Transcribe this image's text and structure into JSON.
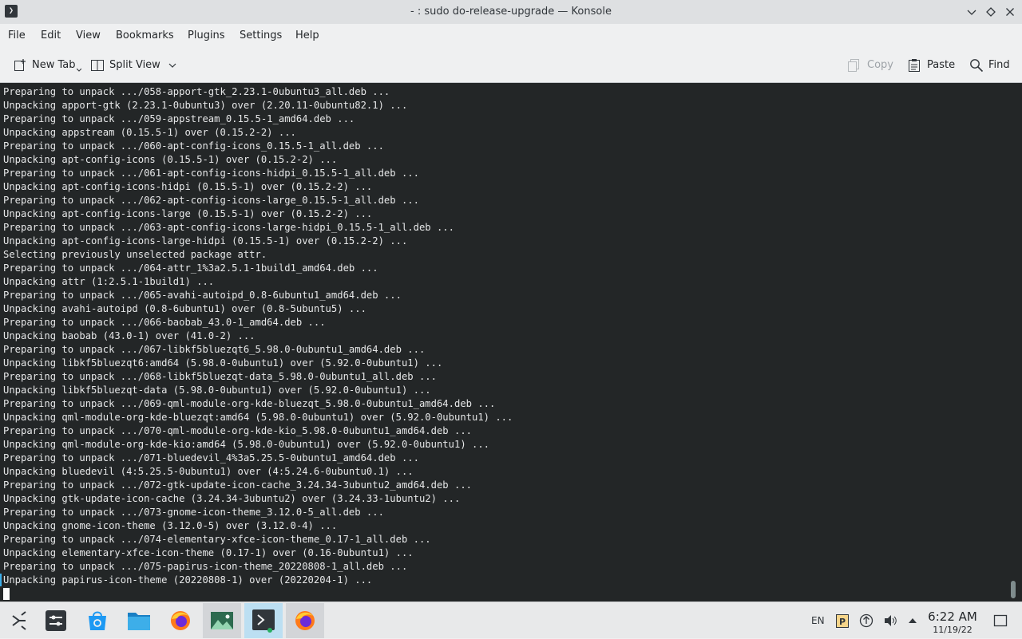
{
  "window": {
    "title": "- : sudo do-release-upgrade — Konsole",
    "app_icon_glyph": "❯"
  },
  "menubar": {
    "items": [
      "File",
      "Edit",
      "View",
      "Bookmarks",
      "Plugins",
      "Settings",
      "Help"
    ]
  },
  "toolbar": {
    "new_tab_label": "New Tab",
    "split_view_label": "Split View",
    "copy_label": "Copy",
    "paste_label": "Paste",
    "find_label": "Find"
  },
  "terminal": {
    "lines": [
      "Preparing to unpack .../058-apport-gtk_2.23.1-0ubuntu3_all.deb ...",
      "Unpacking apport-gtk (2.23.1-0ubuntu3) over (2.20.11-0ubuntu82.1) ...",
      "Preparing to unpack .../059-appstream_0.15.5-1_amd64.deb ...",
      "Unpacking appstream (0.15.5-1) over (0.15.2-2) ...",
      "Preparing to unpack .../060-apt-config-icons_0.15.5-1_all.deb ...",
      "Unpacking apt-config-icons (0.15.5-1) over (0.15.2-2) ...",
      "Preparing to unpack .../061-apt-config-icons-hidpi_0.15.5-1_all.deb ...",
      "Unpacking apt-config-icons-hidpi (0.15.5-1) over (0.15.2-2) ...",
      "Preparing to unpack .../062-apt-config-icons-large_0.15.5-1_all.deb ...",
      "Unpacking apt-config-icons-large (0.15.5-1) over (0.15.2-2) ...",
      "Preparing to unpack .../063-apt-config-icons-large-hidpi_0.15.5-1_all.deb ...",
      "Unpacking apt-config-icons-large-hidpi (0.15.5-1) over (0.15.2-2) ...",
      "Selecting previously unselected package attr.",
      "Preparing to unpack .../064-attr_1%3a2.5.1-1build1_amd64.deb ...",
      "Unpacking attr (1:2.5.1-1build1) ...",
      "Preparing to unpack .../065-avahi-autoipd_0.8-6ubuntu1_amd64.deb ...",
      "Unpacking avahi-autoipd (0.8-6ubuntu1) over (0.8-5ubuntu5) ...",
      "Preparing to unpack .../066-baobab_43.0-1_amd64.deb ...",
      "Unpacking baobab (43.0-1) over (41.0-2) ...",
      "Preparing to unpack .../067-libkf5bluezqt6_5.98.0-0ubuntu1_amd64.deb ...",
      "Unpacking libkf5bluezqt6:amd64 (5.98.0-0ubuntu1) over (5.92.0-0ubuntu1) ...",
      "Preparing to unpack .../068-libkf5bluezqt-data_5.98.0-0ubuntu1_all.deb ...",
      "Unpacking libkf5bluezqt-data (5.98.0-0ubuntu1) over (5.92.0-0ubuntu1) ...",
      "Preparing to unpack .../069-qml-module-org-kde-bluezqt_5.98.0-0ubuntu1_amd64.deb ...",
      "Unpacking qml-module-org-kde-bluezqt:amd64 (5.98.0-0ubuntu1) over (5.92.0-0ubuntu1) ...",
      "Preparing to unpack .../070-qml-module-org-kde-kio_5.98.0-0ubuntu1_amd64.deb ...",
      "Unpacking qml-module-org-kde-kio:amd64 (5.98.0-0ubuntu1) over (5.92.0-0ubuntu1) ...",
      "Preparing to unpack .../071-bluedevil_4%3a5.25.5-0ubuntu1_amd64.deb ...",
      "Unpacking bluedevil (4:5.25.5-0ubuntu1) over (4:5.24.6-0ubuntu0.1) ...",
      "Preparing to unpack .../072-gtk-update-icon-cache_3.24.34-3ubuntu2_amd64.deb ...",
      "Unpacking gtk-update-icon-cache (3.24.34-3ubuntu2) over (3.24.33-1ubuntu2) ...",
      "Preparing to unpack .../073-gnome-icon-theme_3.12.0-5_all.deb ...",
      "Unpacking gnome-icon-theme (3.12.0-5) over (3.12.0-4) ...",
      "Preparing to unpack .../074-elementary-xfce-icon-theme_0.17-1_all.deb ...",
      "Unpacking elementary-xfce-icon-theme (0.17-1) over (0.16-0ubuntu1) ...",
      "Preparing to unpack .../075-papirus-icon-theme_20220808-1_all.deb ...",
      "Unpacking papirus-icon-theme (20220808-1) over (20220204-1) ..."
    ]
  },
  "taskbar": {
    "tray_language": "EN",
    "clock_time": "6:22 AM",
    "clock_date": "11/19/22"
  },
  "colors": {
    "terminal_bg": "#232627",
    "terminal_fg": "#e6e7e8",
    "accent": "#3daee9",
    "titlebar_bg": "#dee0e2",
    "chrome_bg": "#eff0f1"
  }
}
